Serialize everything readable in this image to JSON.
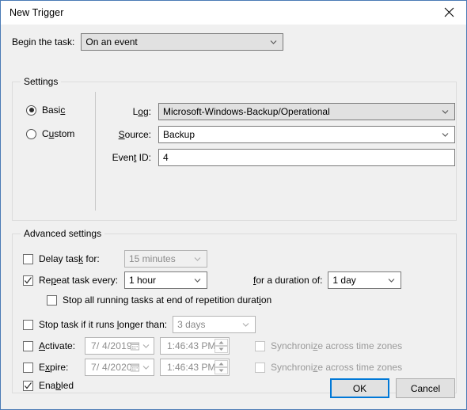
{
  "window": {
    "title": "New Trigger",
    "close_icon": "close-icon",
    "accent_color": "#0078d7",
    "border_color": "#4a7ab5",
    "background": "#f0f0f0"
  },
  "begin": {
    "label": "Begin the task:",
    "value": "On an event",
    "chevron_icon": "chevron-down-icon"
  },
  "settings": {
    "group_title": "Settings",
    "mode": {
      "basic": {
        "label": "Basic",
        "selected": true
      },
      "custom": {
        "label": "Custom",
        "selected": false
      }
    },
    "fields": [
      {
        "label": "Log:",
        "value": "Microsoft-Windows-Backup/Operational",
        "type": "combo",
        "shaded": true
      },
      {
        "label": "Source:",
        "value": "Backup",
        "type": "combo",
        "shaded": false
      },
      {
        "label": "Event ID:",
        "value": "4",
        "type": "text"
      }
    ]
  },
  "advanced": {
    "group_title": "Advanced settings",
    "delay": {
      "label": "Delay task for:",
      "checked": false,
      "value": "15 minutes",
      "enabled": false
    },
    "repeat": {
      "label": "Repeat task every:",
      "checked": true,
      "value": "1 hour",
      "enabled": true,
      "duration_label": "for a duration of:",
      "duration_value": "1 day"
    },
    "stop_repetition": {
      "label": "Stop all running tasks at end of repetition duration",
      "checked": false
    },
    "stop_longer": {
      "label": "Stop task if it runs longer than:",
      "checked": false,
      "value": "3 days",
      "enabled": false
    },
    "activate": {
      "label": "Activate:",
      "checked": false,
      "date": "7/  4/2019",
      "time": "1:46:43 PM",
      "sync_label": "Synchronize across time zones",
      "sync_checked": false
    },
    "expire": {
      "label": "Expire:",
      "checked": false,
      "date": "7/  4/2020",
      "time": "1:46:43 PM",
      "sync_label": "Synchronize across time zones",
      "sync_checked": false
    },
    "enabled": {
      "label": "Enabled",
      "checked": true
    }
  },
  "footer": {
    "ok": "OK",
    "cancel": "Cancel"
  }
}
